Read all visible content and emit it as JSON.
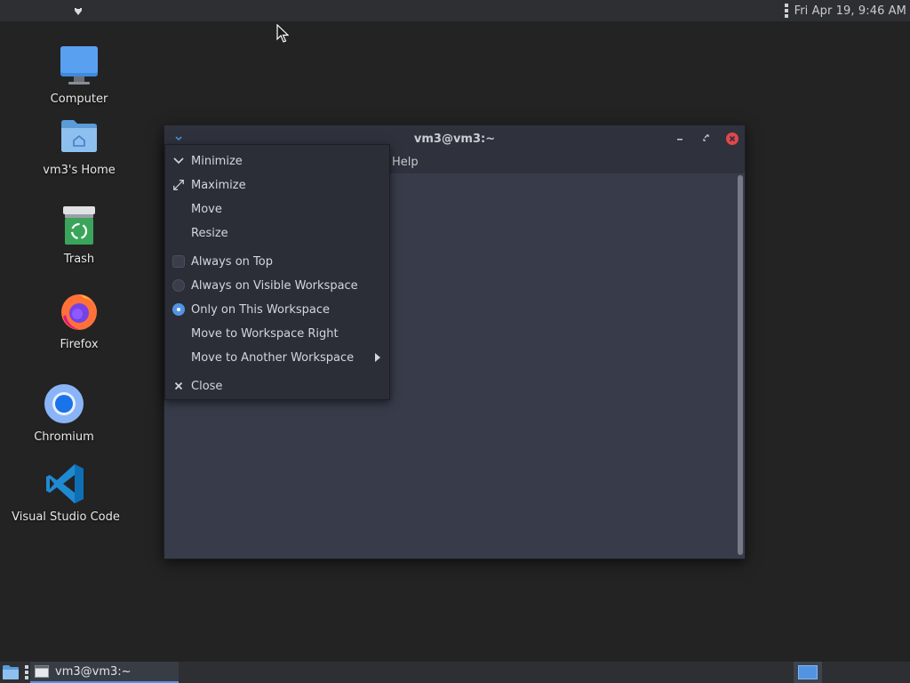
{
  "top_panel": {
    "clock": "Fri Apr 19,  9:46 AM"
  },
  "desktop": {
    "icons": [
      {
        "label": "Computer",
        "icon": "computer-icon"
      },
      {
        "label": "vm3's Home",
        "icon": "home-folder-icon"
      },
      {
        "label": "Trash",
        "icon": "trash-icon"
      },
      {
        "label": "Firefox",
        "icon": "firefox-icon"
      },
      {
        "label": "Chromium",
        "icon": "chromium-icon"
      },
      {
        "label": "Visual Studio Code",
        "icon": "vscode-icon"
      }
    ]
  },
  "window": {
    "title": "vm3@vm3:~",
    "menubar": {
      "help": "Help"
    }
  },
  "context_menu": {
    "items": [
      {
        "label": "Minimize",
        "icon": "minimize-chevron-icon"
      },
      {
        "label": "Maximize",
        "icon": "maximize-arrows-icon"
      },
      {
        "label": "Move"
      },
      {
        "label": "Resize"
      },
      {
        "label": "Always on Top",
        "control": "checkbox",
        "checked": false
      },
      {
        "label": "Always on Visible Workspace",
        "control": "radio",
        "checked": false
      },
      {
        "label": "Only on This Workspace",
        "control": "radio",
        "checked": true
      },
      {
        "label": "Move to Workspace Right"
      },
      {
        "label": "Move to Another Workspace",
        "submenu": true
      },
      {
        "label": "Close",
        "icon": "close-x-icon"
      }
    ]
  },
  "taskbar": {
    "task_label": "vm3@vm3:~"
  },
  "colors": {
    "accent": "#5294e2",
    "close_button": "#e0474b"
  }
}
